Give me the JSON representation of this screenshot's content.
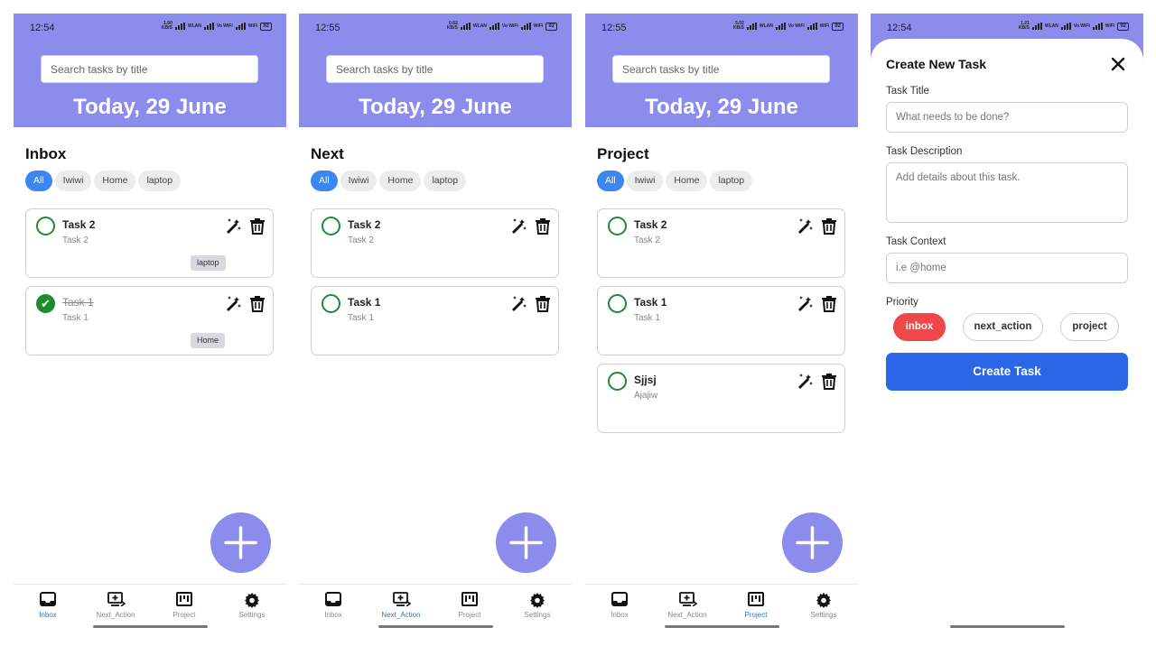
{
  "screens": [
    {
      "status": {
        "time": "12:54",
        "speed": "1.60",
        "speed_unit": "KB/S",
        "net": "WLAN",
        "wifi": "Vo WiFi",
        "wifi2": "WiFi",
        "battery": "92"
      },
      "search_placeholder": "Search tasks by title",
      "date_label": "Today, 29 June",
      "section_title": "Inbox",
      "chips": [
        "All",
        "Iwiwi",
        "Home",
        "laptop"
      ],
      "tasks": [
        {
          "title": "Task 2",
          "desc": "Task 2",
          "tag": "laptop",
          "done": false
        },
        {
          "title": "Task 1",
          "desc": "Task 1",
          "tag": "Home",
          "done": true
        }
      ],
      "active_nav": "Inbox"
    },
    {
      "status": {
        "time": "12:55",
        "speed": "0.62",
        "speed_unit": "KB/S",
        "net": "WLAN",
        "wifi": "Vo WiFi",
        "wifi2": "WiFi",
        "battery": "92"
      },
      "search_placeholder": "Search tasks by title",
      "date_label": "Today, 29 June",
      "section_title": "Next",
      "chips": [
        "All",
        "Iwiwi",
        "Home",
        "laptop"
      ],
      "tasks": [
        {
          "title": "Task 2",
          "desc": "Task 2",
          "tag": "",
          "done": false
        },
        {
          "title": "Task 1",
          "desc": "Task 1",
          "tag": "",
          "done": false
        }
      ],
      "active_nav": "Next_Action"
    },
    {
      "status": {
        "time": "12:55",
        "speed": "5.02",
        "speed_unit": "KB/S",
        "net": "WLAN",
        "wifi": "Vo WiFi",
        "wifi2": "WiFi",
        "battery": "92"
      },
      "search_placeholder": "Search tasks by title",
      "date_label": "Today, 29 June",
      "section_title": "Project",
      "chips": [
        "All",
        "Iwiwi",
        "Home",
        "laptop"
      ],
      "tasks": [
        {
          "title": "Task 2",
          "desc": "Task 2",
          "tag": "",
          "done": false
        },
        {
          "title": "Task 1",
          "desc": "Task 1",
          "tag": "",
          "done": false
        },
        {
          "title": "Sjjsj",
          "desc": "Ajajiw",
          "tag": "",
          "done": false
        }
      ],
      "active_nav": "Project"
    }
  ],
  "nav_items": [
    {
      "label": "Inbox",
      "icon": "inbox-icon"
    },
    {
      "label": "Next_Action",
      "icon": "next-action-icon"
    },
    {
      "label": "Project",
      "icon": "project-icon"
    },
    {
      "label": "Settings",
      "icon": "gear-icon"
    }
  ],
  "modal": {
    "status": {
      "time": "12:54",
      "speed": "1.21",
      "speed_unit": "KB/S",
      "net": "WLAN",
      "wifi": "Vo WiFi",
      "wifi2": "WiFi",
      "battery": "92"
    },
    "title": "Create New Task",
    "task_title_label": "Task Title",
    "task_title_placeholder": "What needs to be done?",
    "task_desc_label": "Task Description",
    "task_desc_placeholder": "Add details about this task.",
    "task_context_label": "Task Context",
    "task_context_placeholder": "i.e @home",
    "priority_label": "Priority",
    "priorities": [
      "inbox",
      "next_action",
      "project"
    ],
    "selected_priority": "inbox",
    "create_button": "Create Task"
  },
  "colors": {
    "header": "#8b8cec",
    "chip_active": "#3b86f0",
    "check_green": "#1f8a2e",
    "nav_active": "#2677c9",
    "priority_selected": "#f04848",
    "create_button": "#2b66e6"
  }
}
